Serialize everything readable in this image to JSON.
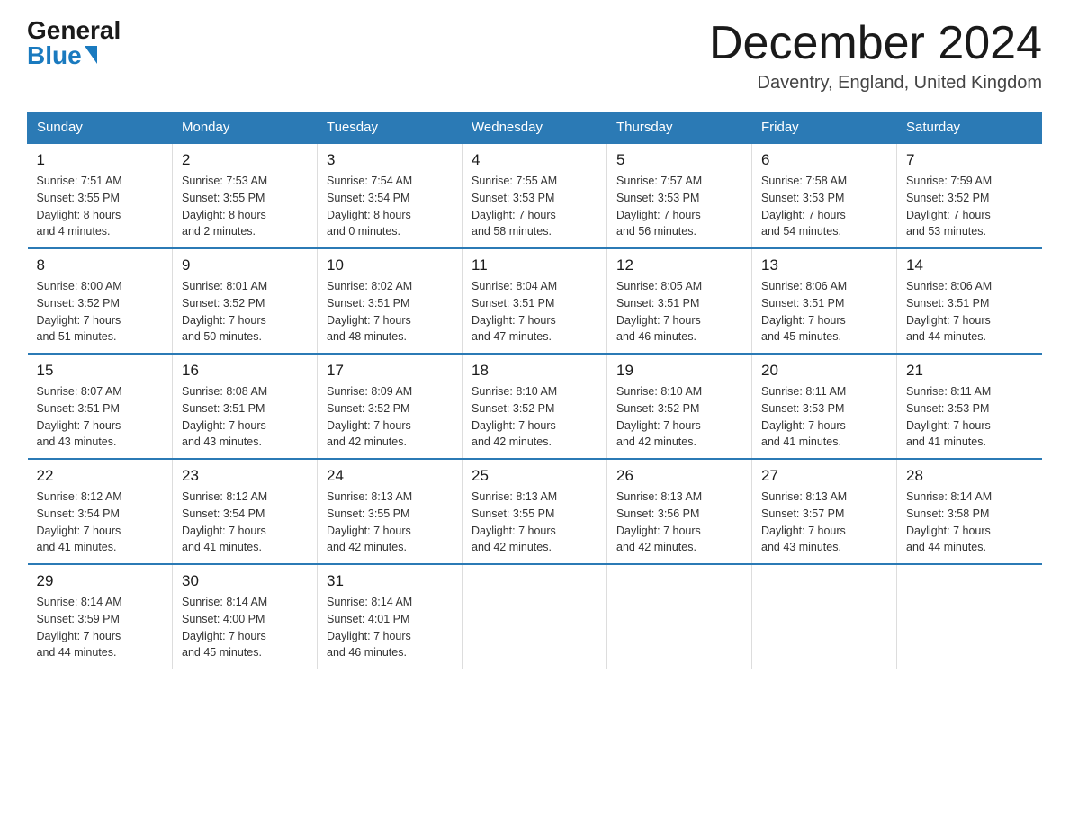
{
  "header": {
    "logo_general": "General",
    "logo_blue": "Blue",
    "month_title": "December 2024",
    "location": "Daventry, England, United Kingdom"
  },
  "days_of_week": [
    "Sunday",
    "Monday",
    "Tuesday",
    "Wednesday",
    "Thursday",
    "Friday",
    "Saturday"
  ],
  "weeks": [
    [
      {
        "day": "1",
        "sunrise": "7:51 AM",
        "sunset": "3:55 PM",
        "daylight": "8 hours and 4 minutes."
      },
      {
        "day": "2",
        "sunrise": "7:53 AM",
        "sunset": "3:55 PM",
        "daylight": "8 hours and 2 minutes."
      },
      {
        "day": "3",
        "sunrise": "7:54 AM",
        "sunset": "3:54 PM",
        "daylight": "8 hours and 0 minutes."
      },
      {
        "day": "4",
        "sunrise": "7:55 AM",
        "sunset": "3:53 PM",
        "daylight": "7 hours and 58 minutes."
      },
      {
        "day": "5",
        "sunrise": "7:57 AM",
        "sunset": "3:53 PM",
        "daylight": "7 hours and 56 minutes."
      },
      {
        "day": "6",
        "sunrise": "7:58 AM",
        "sunset": "3:53 PM",
        "daylight": "7 hours and 54 minutes."
      },
      {
        "day": "7",
        "sunrise": "7:59 AM",
        "sunset": "3:52 PM",
        "daylight": "7 hours and 53 minutes."
      }
    ],
    [
      {
        "day": "8",
        "sunrise": "8:00 AM",
        "sunset": "3:52 PM",
        "daylight": "7 hours and 51 minutes."
      },
      {
        "day": "9",
        "sunrise": "8:01 AM",
        "sunset": "3:52 PM",
        "daylight": "7 hours and 50 minutes."
      },
      {
        "day": "10",
        "sunrise": "8:02 AM",
        "sunset": "3:51 PM",
        "daylight": "7 hours and 48 minutes."
      },
      {
        "day": "11",
        "sunrise": "8:04 AM",
        "sunset": "3:51 PM",
        "daylight": "7 hours and 47 minutes."
      },
      {
        "day": "12",
        "sunrise": "8:05 AM",
        "sunset": "3:51 PM",
        "daylight": "7 hours and 46 minutes."
      },
      {
        "day": "13",
        "sunrise": "8:06 AM",
        "sunset": "3:51 PM",
        "daylight": "7 hours and 45 minutes."
      },
      {
        "day": "14",
        "sunrise": "8:06 AM",
        "sunset": "3:51 PM",
        "daylight": "7 hours and 44 minutes."
      }
    ],
    [
      {
        "day": "15",
        "sunrise": "8:07 AM",
        "sunset": "3:51 PM",
        "daylight": "7 hours and 43 minutes."
      },
      {
        "day": "16",
        "sunrise": "8:08 AM",
        "sunset": "3:51 PM",
        "daylight": "7 hours and 43 minutes."
      },
      {
        "day": "17",
        "sunrise": "8:09 AM",
        "sunset": "3:52 PM",
        "daylight": "7 hours and 42 minutes."
      },
      {
        "day": "18",
        "sunrise": "8:10 AM",
        "sunset": "3:52 PM",
        "daylight": "7 hours and 42 minutes."
      },
      {
        "day": "19",
        "sunrise": "8:10 AM",
        "sunset": "3:52 PM",
        "daylight": "7 hours and 42 minutes."
      },
      {
        "day": "20",
        "sunrise": "8:11 AM",
        "sunset": "3:53 PM",
        "daylight": "7 hours and 41 minutes."
      },
      {
        "day": "21",
        "sunrise": "8:11 AM",
        "sunset": "3:53 PM",
        "daylight": "7 hours and 41 minutes."
      }
    ],
    [
      {
        "day": "22",
        "sunrise": "8:12 AM",
        "sunset": "3:54 PM",
        "daylight": "7 hours and 41 minutes."
      },
      {
        "day": "23",
        "sunrise": "8:12 AM",
        "sunset": "3:54 PM",
        "daylight": "7 hours and 41 minutes."
      },
      {
        "day": "24",
        "sunrise": "8:13 AM",
        "sunset": "3:55 PM",
        "daylight": "7 hours and 42 minutes."
      },
      {
        "day": "25",
        "sunrise": "8:13 AM",
        "sunset": "3:55 PM",
        "daylight": "7 hours and 42 minutes."
      },
      {
        "day": "26",
        "sunrise": "8:13 AM",
        "sunset": "3:56 PM",
        "daylight": "7 hours and 42 minutes."
      },
      {
        "day": "27",
        "sunrise": "8:13 AM",
        "sunset": "3:57 PM",
        "daylight": "7 hours and 43 minutes."
      },
      {
        "day": "28",
        "sunrise": "8:14 AM",
        "sunset": "3:58 PM",
        "daylight": "7 hours and 44 minutes."
      }
    ],
    [
      {
        "day": "29",
        "sunrise": "8:14 AM",
        "sunset": "3:59 PM",
        "daylight": "7 hours and 44 minutes."
      },
      {
        "day": "30",
        "sunrise": "8:14 AM",
        "sunset": "4:00 PM",
        "daylight": "7 hours and 45 minutes."
      },
      {
        "day": "31",
        "sunrise": "8:14 AM",
        "sunset": "4:01 PM",
        "daylight": "7 hours and 46 minutes."
      },
      null,
      null,
      null,
      null
    ]
  ],
  "labels": {
    "sunrise": "Sunrise:",
    "sunset": "Sunset:",
    "daylight": "Daylight:"
  }
}
